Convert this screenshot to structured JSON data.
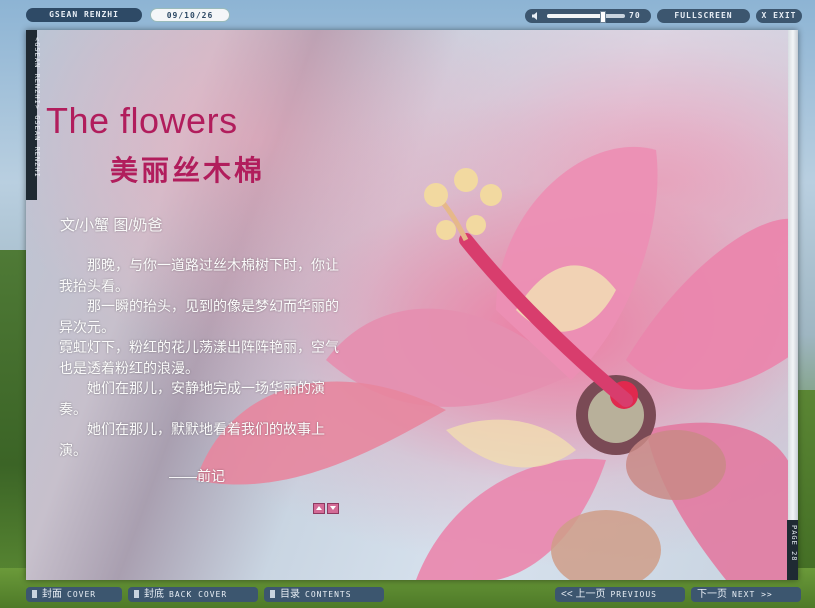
{
  "topbar": {
    "brand": "GSEAN RENZHI",
    "date": "09/10/26",
    "volume_level": 70,
    "volume_label": "70",
    "fullscreen_label": "FULLSCREEN",
    "exit_label": "X EXIT"
  },
  "page": {
    "spine_label": "<GSEAN RENZHI> GSEAN RENZHI",
    "page_number": "PAGE 28",
    "title_en": "The flowers",
    "title_cn": "美丽丝木棉",
    "credit": "文/小蟹  图/奶爸",
    "paragraphs": [
      "　　那晚，与你一道路过丝木棉树下时，你让我抬头看。",
      "　　那一瞬的抬头，见到的像是梦幻而华丽的异次元。",
      "霓虹灯下，粉红的花儿荡漾出阵阵艳丽，空气也是透着粉红的浪漫。",
      "　　她们在那儿，安静地完成一场华丽的演奏。",
      "　　她们在那儿，默默地看着我们的故事上演。"
    ],
    "signature": "——前记"
  },
  "bottombar": {
    "cover_cn": "封面",
    "cover_en": "COVER",
    "back_cn": "封底",
    "back_en": "BACK COVER",
    "toc_cn": "目录",
    "toc_en": "CONTENTS",
    "prev_cn": "<< 上一页",
    "prev_en": "PREVIOUS",
    "next_cn": "下一页",
    "next_en": "NEXT >>"
  },
  "colors": {
    "accent": "#b11d5c",
    "bar": "#3c566f"
  }
}
